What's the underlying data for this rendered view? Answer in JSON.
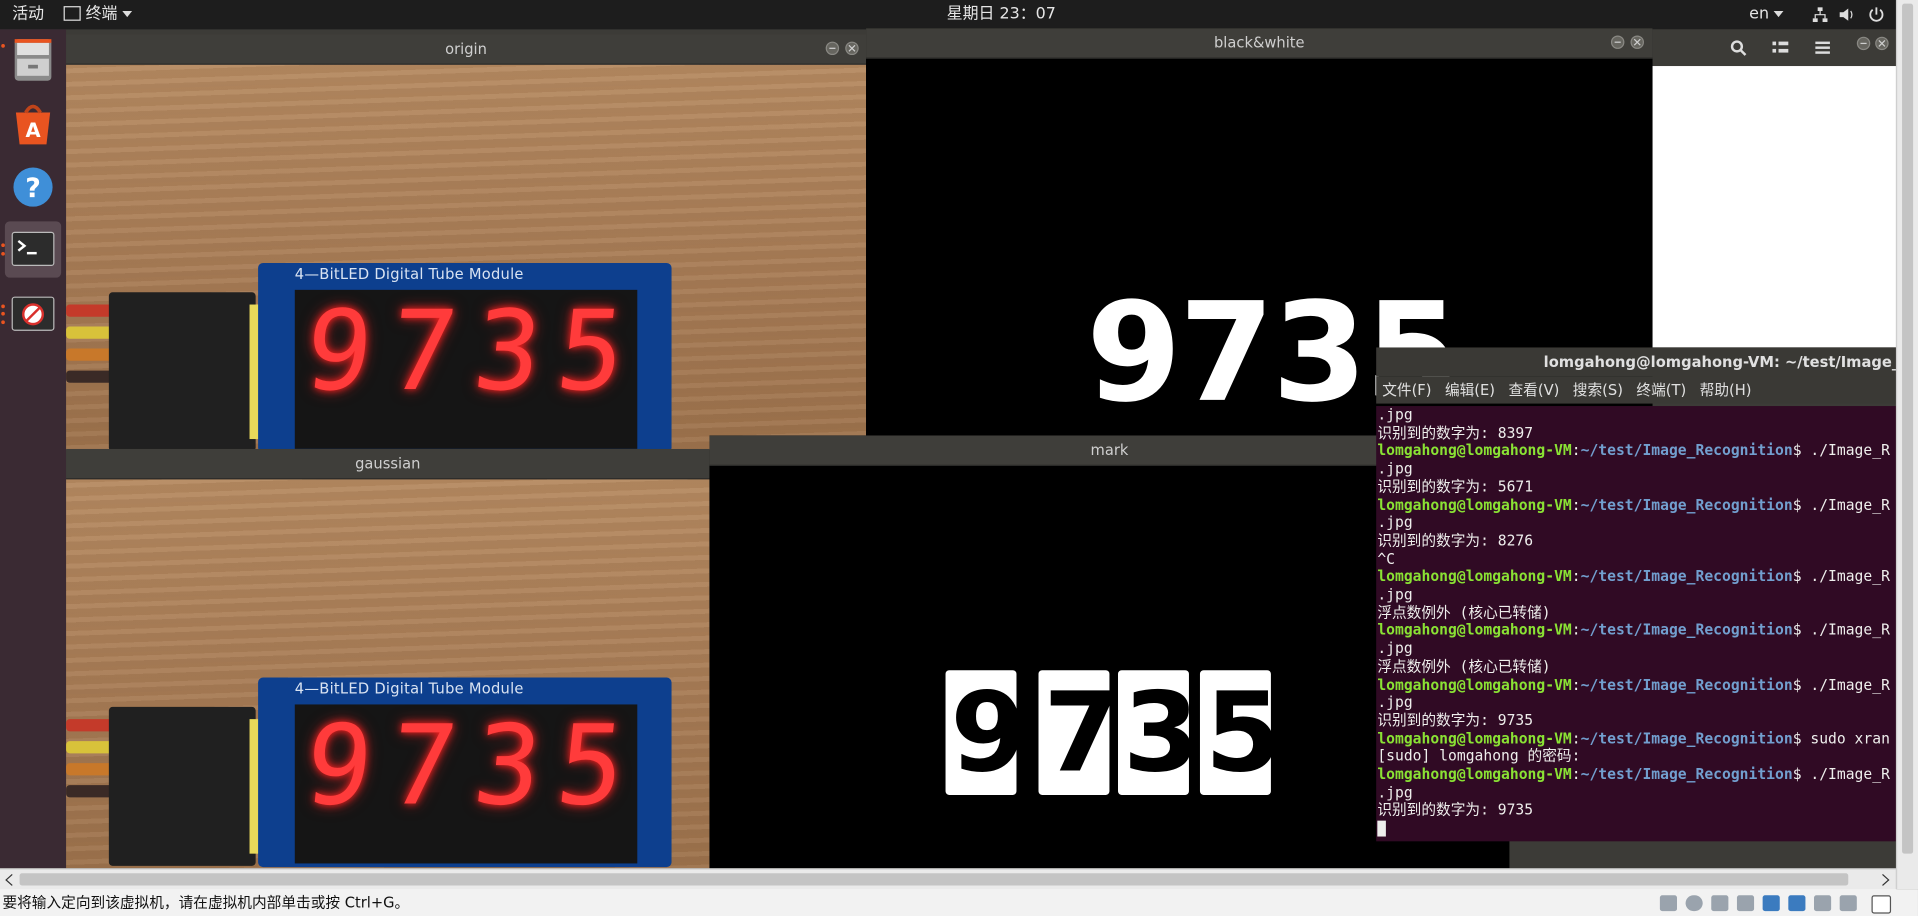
{
  "topbar": {
    "activities": "活动",
    "app_menu": "终端",
    "clock": "星期日 23：07",
    "lang": "en"
  },
  "dock": {
    "items": [
      "files",
      "software-center",
      "help",
      "terminal",
      "blocked"
    ]
  },
  "windows": {
    "origin": {
      "title": "origin"
    },
    "bw": {
      "title": "black&white",
      "digits": "9735"
    },
    "gaussian": {
      "title": "gaussian"
    },
    "mark": {
      "title": "mark",
      "digits": [
        "9",
        "7",
        "3",
        "5"
      ]
    },
    "photo": {
      "module_label": "4—BitLED Digital Tube Module",
      "digits": [
        "9",
        "7",
        "3",
        "5"
      ]
    }
  },
  "terminal": {
    "title": "lomgahong@lomgahong-VM: ~/test/Image_Recog",
    "menu": [
      "文件(F)",
      "编辑(E)",
      "查看(V)",
      "搜索(S)",
      "终端(T)",
      "帮助(H)"
    ],
    "user": "lomgahong@lomgahong-VM",
    "path": "~/test/Image_Recognition",
    "lines": [
      {
        "t": "out",
        "text": ".jpg"
      },
      {
        "t": "out",
        "text": "识别到的数字为: 8397"
      },
      {
        "t": "prompt",
        "cmd": "$ ./Image_R"
      },
      {
        "t": "out",
        "text": ".jpg"
      },
      {
        "t": "out",
        "text": "识别到的数字为: 5671"
      },
      {
        "t": "prompt",
        "cmd": "$ ./Image_R"
      },
      {
        "t": "out",
        "text": ".jpg"
      },
      {
        "t": "out",
        "text": "识别到的数字为: 8276"
      },
      {
        "t": "out",
        "text": "^C"
      },
      {
        "t": "prompt",
        "cmd": "$ ./Image_R"
      },
      {
        "t": "out",
        "text": ".jpg"
      },
      {
        "t": "out",
        "text": "浮点数例外 (核心已转储)"
      },
      {
        "t": "prompt",
        "cmd": "$ ./Image_R"
      },
      {
        "t": "out",
        "text": ".jpg"
      },
      {
        "t": "out",
        "text": "浮点数例外 (核心已转储)"
      },
      {
        "t": "prompt",
        "cmd": "$ ./Image_R"
      },
      {
        "t": "out",
        "text": ".jpg"
      },
      {
        "t": "out",
        "text": "识别到的数字为: 9735"
      },
      {
        "t": "prompt",
        "cmd": "$ sudo xran"
      },
      {
        "t": "out",
        "text": "[sudo] lomgahong 的密码:"
      },
      {
        "t": "prompt",
        "cmd": "$ ./Image_R"
      },
      {
        "t": "out",
        "text": ".jpg"
      },
      {
        "t": "out",
        "text": "识别到的数字为: 9735"
      }
    ]
  },
  "statusbar": {
    "message": "要将输入定向到该虚拟机，请在虚拟机内部单击或按 Ctrl+G。"
  }
}
